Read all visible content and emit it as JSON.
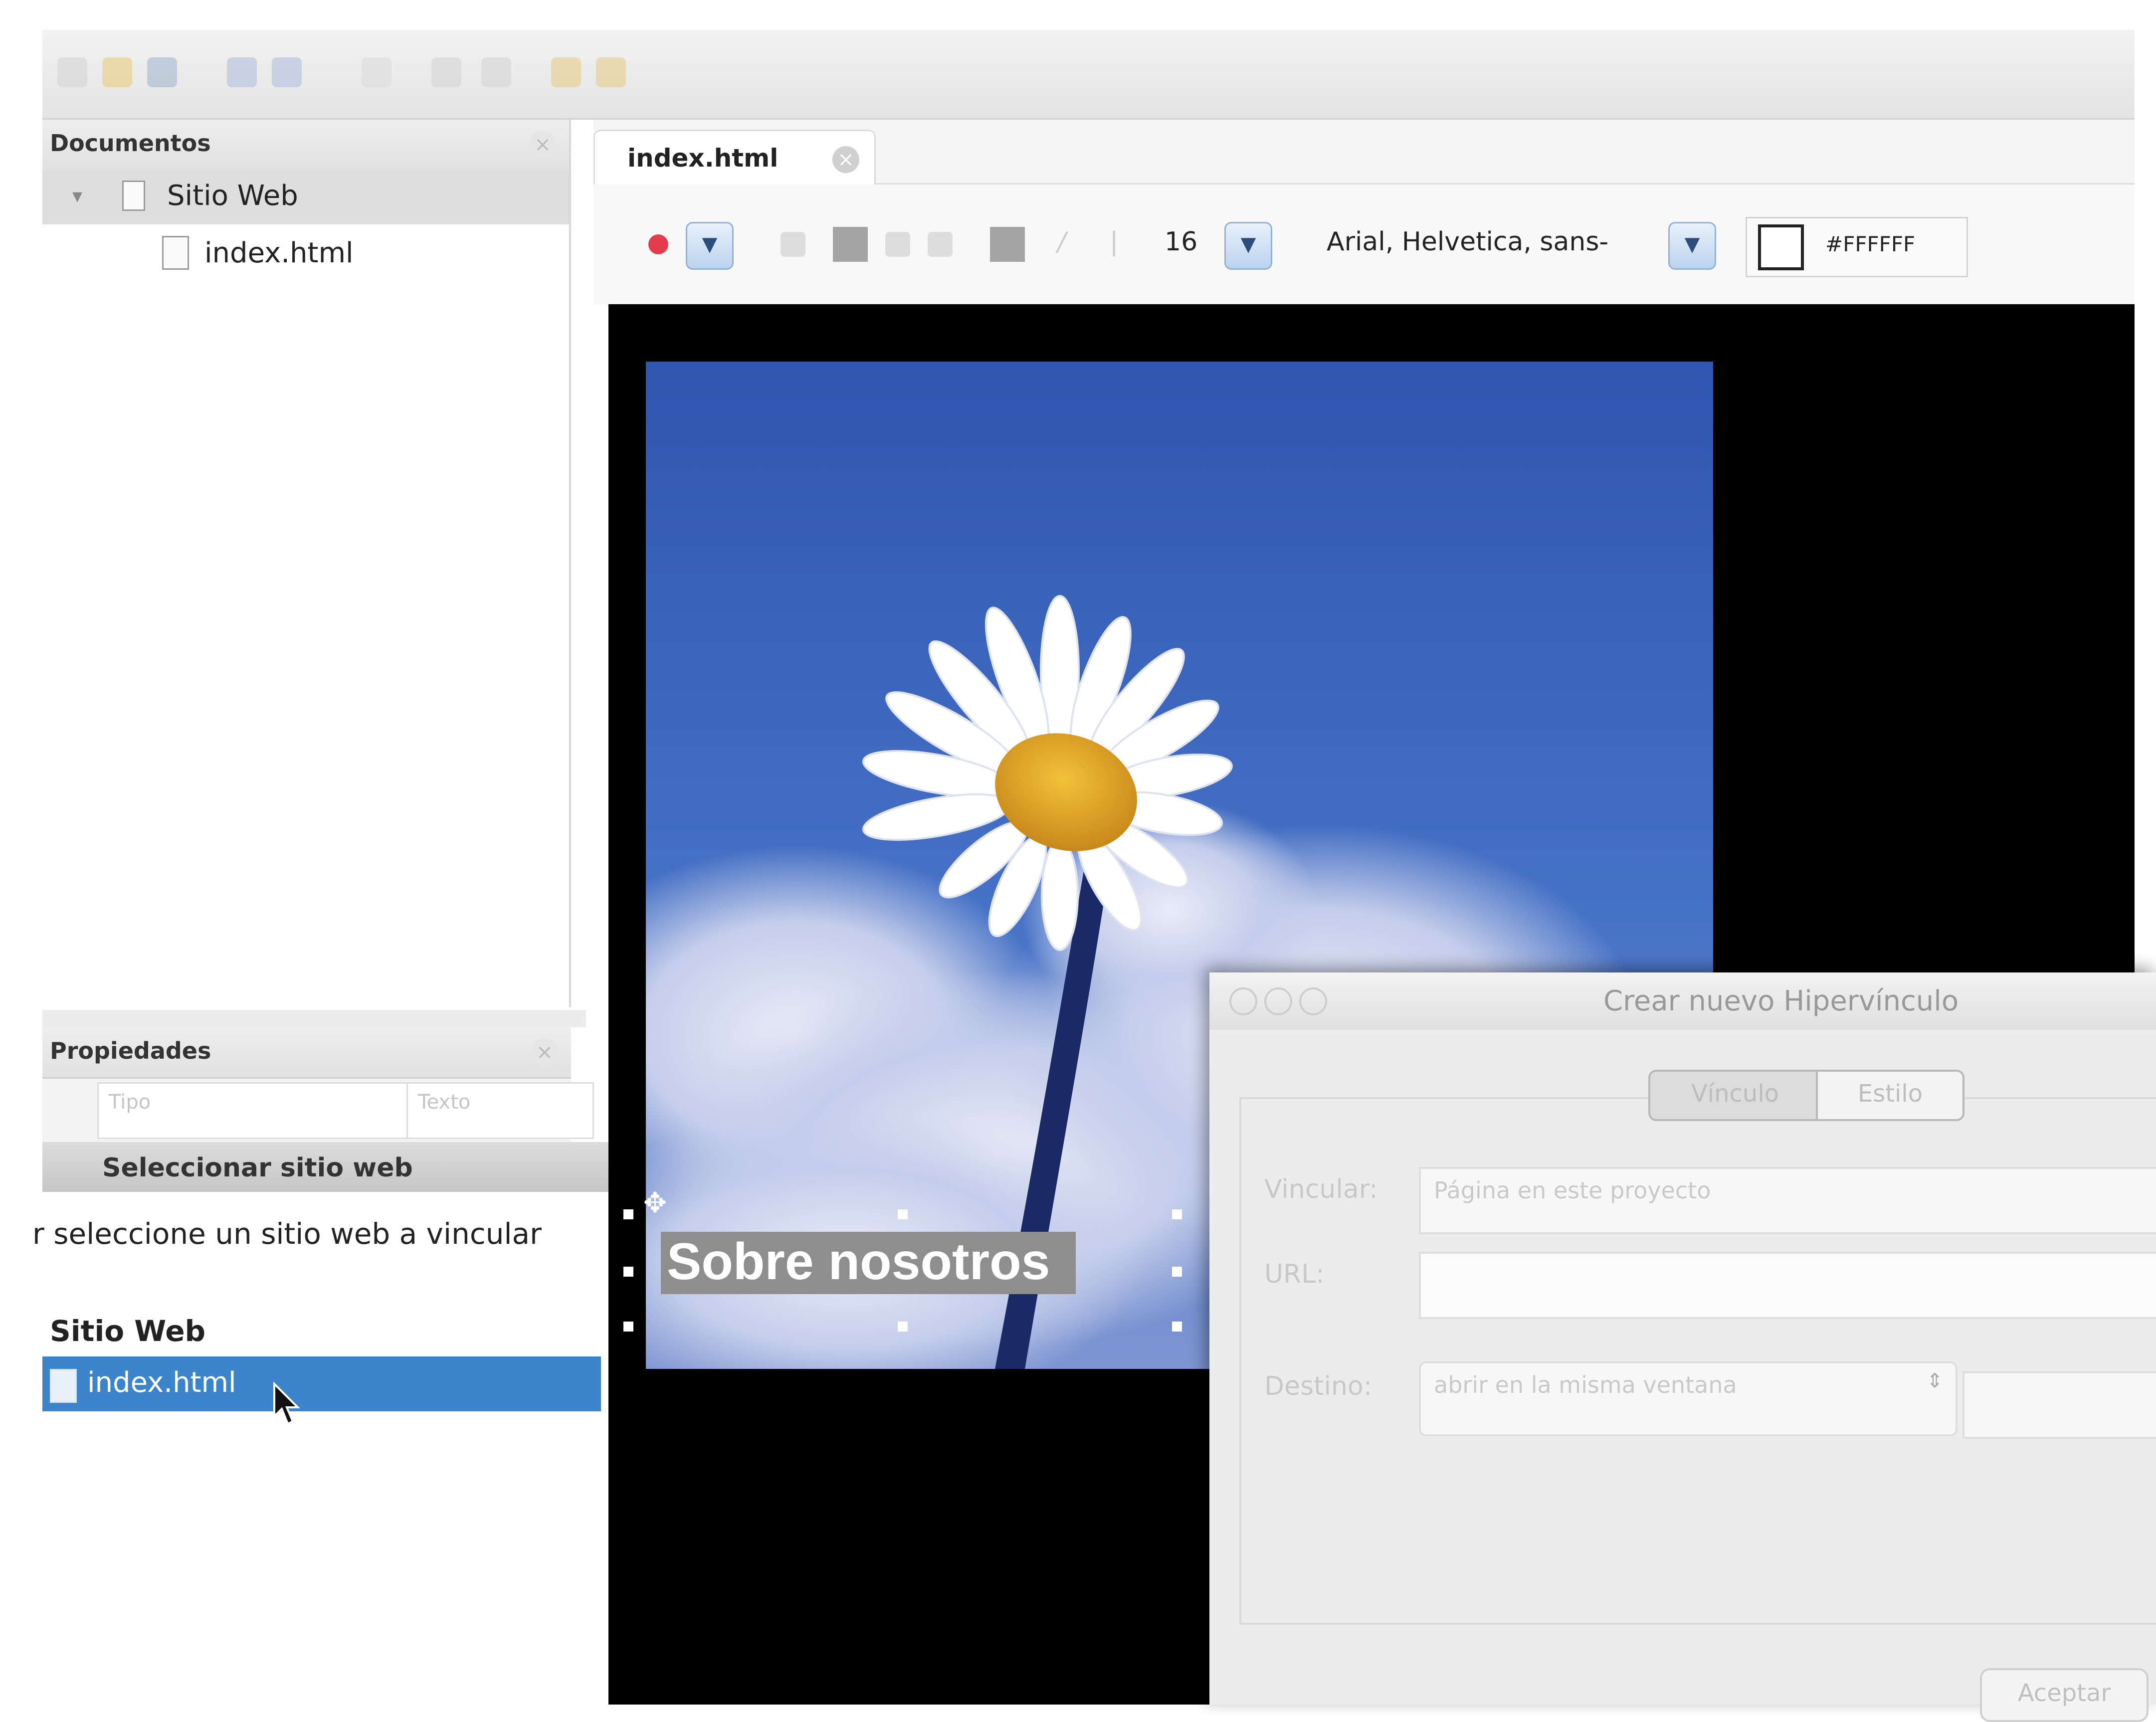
{
  "toolbar": {
    "icons": [
      "new-file-icon",
      "open-folder-icon",
      "save-icon",
      "undo-icon",
      "redo-icon",
      "cut-icon",
      "copy-icon",
      "paste-icon",
      "preview-icon",
      "publish-icon"
    ]
  },
  "documents_panel": {
    "title": "Documentos",
    "tree": {
      "root_label": "Sitio Web",
      "file_label": "index.html"
    }
  },
  "properties_panel": {
    "title": "Propiedades",
    "col_type": "Tipo",
    "col_value": "Texto"
  },
  "select_site_dialog": {
    "title": "Seleccionar sitio web",
    "prompt": "r seleccione un sitio web a vincular",
    "list_header": "Sitio Web",
    "selected_item": "index.html"
  },
  "editor": {
    "tab_label": "index.html",
    "font_size": "16",
    "font_family": "Arial, Helvetica, sans-",
    "color_value": "#FFFFFF",
    "link_text": "Sobre nosotros"
  },
  "hyperlink_dialog": {
    "title": "Crear nuevo Hipervínculo",
    "tabs": [
      "Vínculo",
      "Estilo"
    ],
    "vincular_label": "Vincular:",
    "vincular_value": "Página en este proyecto",
    "url_label": "URL:",
    "url_value": "",
    "destino_label": "Destino:",
    "destino_value": "abrir en la misma ventana",
    "accept_label": "Aceptar"
  },
  "colors": {
    "selection_blue": "#3c85cc",
    "canvas_black": "#000000",
    "sky_blue": "#3b63b8"
  }
}
